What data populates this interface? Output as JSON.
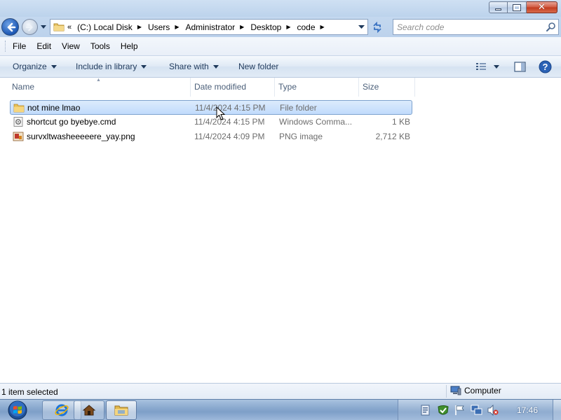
{
  "window": {
    "caption_buttons": [
      "minimize",
      "maximize",
      "close"
    ]
  },
  "navigation": {
    "breadcrumbs": [
      "(C:) Local Disk",
      "Users",
      "Administrator",
      "Desktop",
      "code"
    ],
    "search_placeholder": "Search code"
  },
  "menu": {
    "items": [
      "File",
      "Edit",
      "View",
      "Tools",
      "Help"
    ]
  },
  "commands": {
    "organize": "Organize",
    "include_in_library": "Include in library",
    "share_with": "Share with",
    "new_folder": "New folder"
  },
  "columns": {
    "name": "Name",
    "date_modified": "Date modified",
    "type": "Type",
    "size": "Size"
  },
  "files": [
    {
      "name": "not mine lmao",
      "date": "11/4/2024 4:15 PM",
      "type": "File folder",
      "size": "",
      "icon": "folder-icon",
      "selected": true
    },
    {
      "name": "shortcut go byebye.cmd",
      "date": "11/4/2024 4:15 PM",
      "type": "Windows Comma...",
      "size": "1 KB",
      "icon": "cmd-file-icon",
      "selected": false
    },
    {
      "name": "survxltwasheeeeere_yay.png",
      "date": "11/4/2024 4:09 PM",
      "type": "PNG image",
      "size": "2,712 KB",
      "icon": "png-file-icon",
      "selected": false
    }
  ],
  "status": {
    "selection": "1 item selected",
    "location": "Computer"
  },
  "taskbar": {
    "clock": "17:46"
  },
  "colors": {
    "selection": "#cce0fb",
    "selection_border": "#7da2ce",
    "chrome": "#c4d8ef"
  }
}
